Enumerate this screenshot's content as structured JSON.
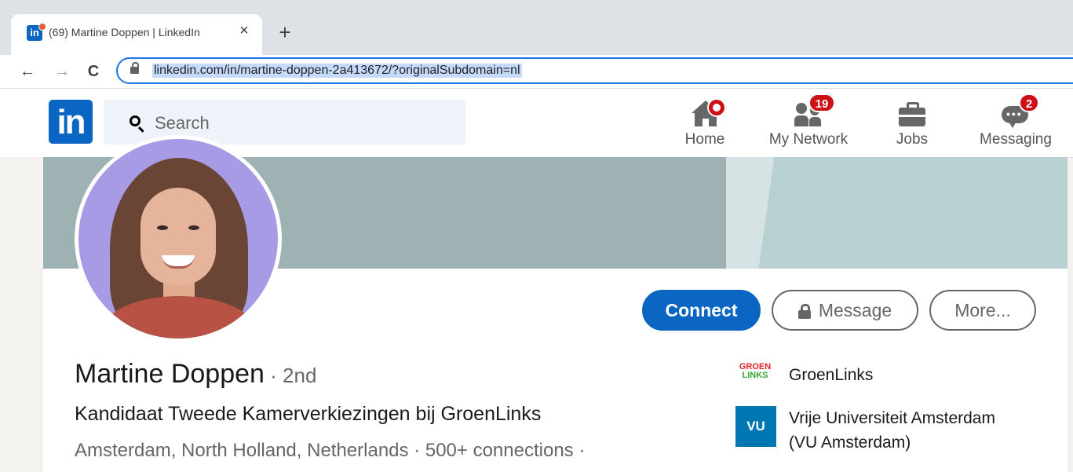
{
  "browser": {
    "tab_title": "(69) Martine Doppen | LinkedIn",
    "tab_close": "×",
    "new_tab": "+",
    "back": "←",
    "forward": "→",
    "reload": "C",
    "url": "linkedin.com/in/martine-doppen-2a413672/?originalSubdomain=nl"
  },
  "linkedin_nav": {
    "logo": "in",
    "search_placeholder": "Search",
    "items": [
      {
        "label": "Home",
        "badge": "",
        "icon": "home-icon"
      },
      {
        "label": "My Network",
        "badge": "19",
        "icon": "people-icon"
      },
      {
        "label": "Jobs",
        "badge": "",
        "icon": "briefcase-icon"
      },
      {
        "label": "Messaging",
        "badge": "2",
        "icon": "messaging-icon"
      }
    ]
  },
  "profile": {
    "name": "Martine Doppen",
    "degree": " · 2nd",
    "headline": "Kandidaat Tweede Kamerverkiezingen bij GroenLinks",
    "location_connections": "Amsterdam, North Holland, Netherlands  ·  500+ connections  ·",
    "actions": {
      "connect": "Connect",
      "message": "Message",
      "more": "More..."
    },
    "organizations": [
      {
        "name": "GroenLinks",
        "logo_top": "GROEN",
        "logo_bottom": "LINKS"
      },
      {
        "name_line1": "Vrije Universiteit Amsterdam",
        "name_line2": "(VU Amsterdam)",
        "logo": "VU"
      }
    ]
  },
  "colors": {
    "linkedin_blue": "#0a66c2",
    "badge_red": "#cc1016",
    "banner_gray": "#9eb1b3",
    "banner_light": "#b9d0d3"
  }
}
